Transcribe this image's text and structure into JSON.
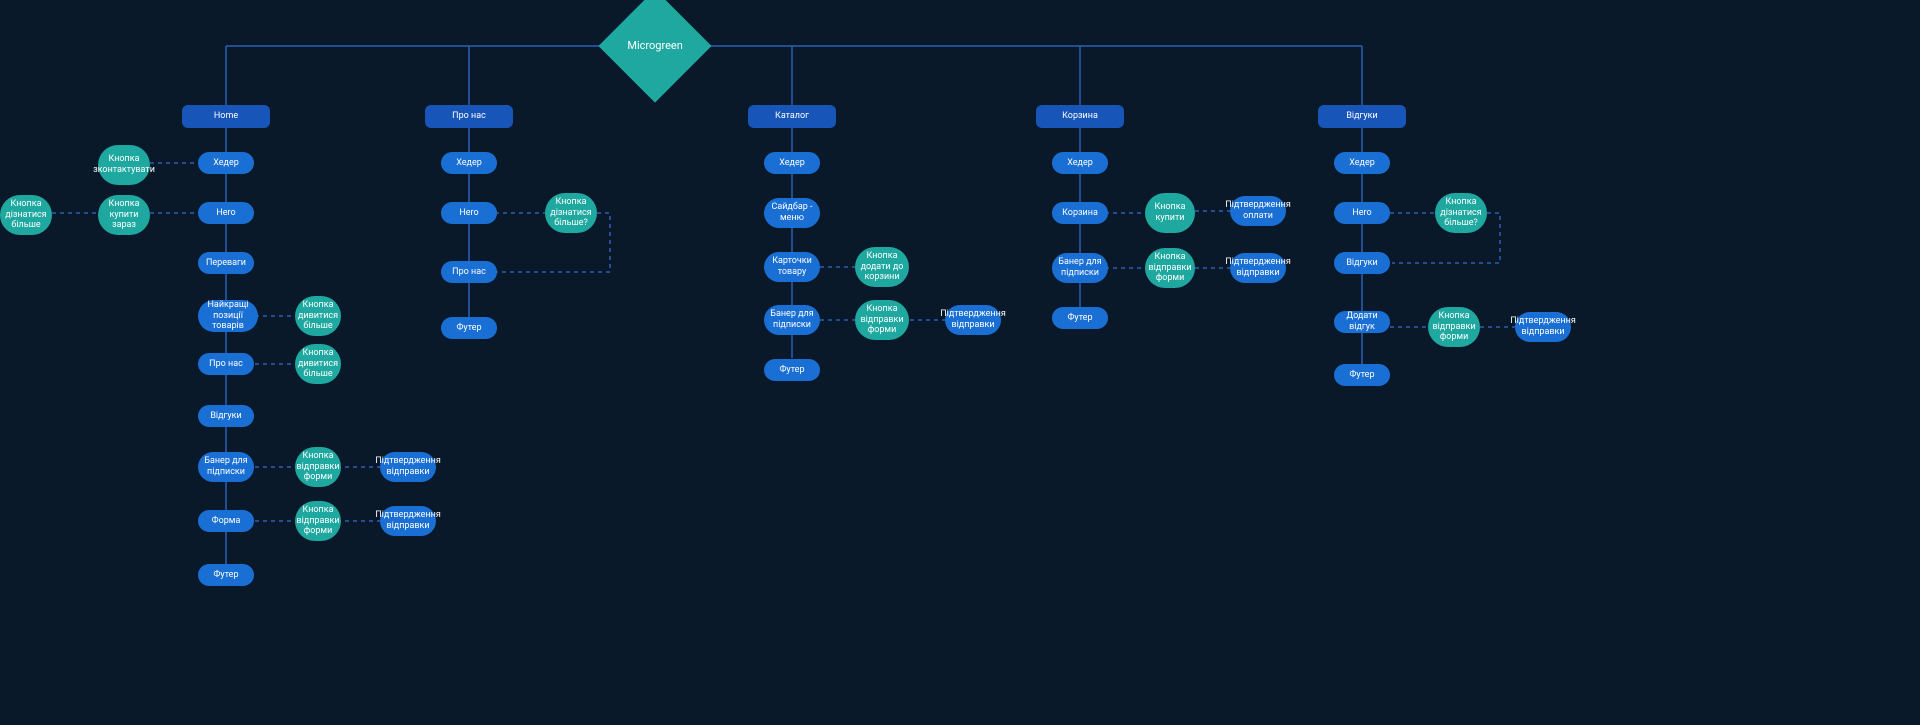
{
  "root": {
    "label": "Microgreen"
  },
  "branches": {
    "home": {
      "label": "Home",
      "items": {
        "header": "Хедер",
        "hero": "Hero",
        "benefits": "Переваги",
        "best": "Найкращі позиції товарів",
        "about": "Про нас",
        "reviews": "Відгуки",
        "banner": "Банер для підписки",
        "form": "Форма",
        "footer": "Футер",
        "contact_btn": "Кнопка зконтактувати",
        "buy_btn": "Кнопка купити зараз",
        "learn_more": "Кнопка дізнатися більше",
        "more_btn1": "Кнопка дивитися більше",
        "more_btn2": "Кнопка дивитися більше",
        "send_btn1": "Кнопка відправки форми",
        "send_btn2": "Кнопка відправки форми",
        "confirm1": "Підтвердження відправки",
        "confirm2": "Підтвердження відправки"
      }
    },
    "about": {
      "label": "Про нас",
      "items": {
        "header": "Хедер",
        "hero": "Hero",
        "about": "Про нас",
        "footer": "Футер",
        "learn_btn": "Кнопка дізнатися більше?"
      }
    },
    "catalog": {
      "label": "Каталог",
      "items": {
        "header": "Хедер",
        "sidebar": "Сайдбар - меню",
        "card": "Карточки товару",
        "banner": "Банер для підписки",
        "footer": "Футер",
        "add_btn": "Кнопка додати до корзини",
        "send_btn": "Кнопка відправки форми",
        "confirm": "Підтвердження відправки"
      }
    },
    "cart": {
      "label": "Корзина",
      "items": {
        "header": "Хедер",
        "cart": "Корзина",
        "banner": "Банер для підписки",
        "footer": "Футер",
        "buy_btn": "Кнопка купити",
        "send_btn": "Кнопка відправки форми",
        "pay_confirm": "Підтвердження оплати",
        "send_confirm": "Підтвердження відправки"
      }
    },
    "reviews": {
      "label": "Відгуки",
      "items": {
        "header": "Хедер",
        "hero": "Hero",
        "reviews": "Відгуки",
        "add_review": "Додати відгук",
        "footer": "Футер",
        "learn_btn": "Кнопка дізнатися більше?",
        "send_btn": "Кнопка відправки форми",
        "confirm": "Підтвердження відправки"
      }
    }
  }
}
